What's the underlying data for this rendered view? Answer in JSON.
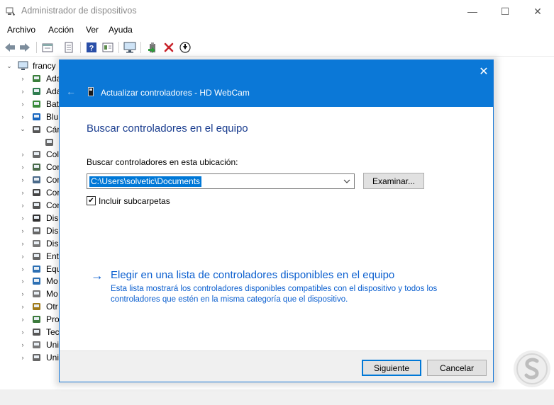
{
  "window": {
    "title": "Administrador de dispositivos",
    "minimize_glyph": "—",
    "maximize_glyph": "☐",
    "close_glyph": "✕"
  },
  "menu": [
    "Archivo",
    "Acción",
    "Ver",
    "Ayuda"
  ],
  "toolbar": {
    "icons": [
      "back-arrow-icon",
      "forward-arrow-icon",
      "properties-icon",
      "printer-icon",
      "help-icon",
      "view-icon",
      "monitor-icon",
      "update-driver-icon",
      "uninstall-icon",
      "download-icon"
    ]
  },
  "tree": {
    "root_label": "francy",
    "items": [
      {
        "label": "Ada",
        "icon": "audio-icon",
        "expander": "›"
      },
      {
        "label": "Ada",
        "icon": "display-adapter-icon",
        "expander": "›"
      },
      {
        "label": "Bat",
        "icon": "battery-icon",
        "expander": "›"
      },
      {
        "label": "Blu",
        "icon": "bluetooth-icon",
        "expander": "›"
      },
      {
        "label": "Cám",
        "icon": "camera-icon",
        "expander": "⌄"
      },
      {
        "label": "",
        "icon": "webcam-icon",
        "expander": ""
      },
      {
        "label": "Col",
        "icon": "printer-queue-icon",
        "expander": "›"
      },
      {
        "label": "Con",
        "icon": "controller-icon",
        "expander": "›"
      },
      {
        "label": "Con",
        "icon": "storage-controller-icon",
        "expander": "›"
      },
      {
        "label": "Con",
        "icon": "usb-icon",
        "expander": "›"
      },
      {
        "label": "Con",
        "icon": "usb-connector-icon",
        "expander": "›"
      },
      {
        "label": "Disp",
        "icon": "portable-device-icon",
        "expander": "›"
      },
      {
        "label": "Disp",
        "icon": "disk-icon",
        "expander": "›"
      },
      {
        "label": "Disp",
        "icon": "hid-icon",
        "expander": "›"
      },
      {
        "label": "Ent",
        "icon": "audio-input-icon",
        "expander": "›"
      },
      {
        "label": "Equ",
        "icon": "computer-icon",
        "expander": "›"
      },
      {
        "label": "Mo",
        "icon": "monitor-icon",
        "expander": "›"
      },
      {
        "label": "Mo",
        "icon": "mouse-icon",
        "expander": "›"
      },
      {
        "label": "Otr",
        "icon": "unknown-device-icon",
        "expander": "›"
      },
      {
        "label": "Pro",
        "icon": "processor-icon",
        "expander": "›"
      },
      {
        "label": "Tec",
        "icon": "keyboard-icon",
        "expander": "›"
      },
      {
        "label": "Uni",
        "icon": "dvd-icon",
        "expander": "›"
      },
      {
        "label": "Uni",
        "icon": "drive-icon",
        "expander": "›"
      }
    ]
  },
  "dialog": {
    "title": "Actualizar controladores - HD WebCam",
    "close_glyph": "✕",
    "back_glyph": "←",
    "heading": "Buscar controladores en el equipo",
    "location_label": "Buscar controladores en esta ubicación:",
    "path_value": "C:\\Users\\solvetic\\Documents",
    "browse_label": "Examinar...",
    "include_subfolders_label": "Incluir subcarpetas",
    "include_subfolders_checked": true,
    "check_glyph": "✔",
    "link_arrow": "→",
    "link_title": "Elegir en una lista de controladores disponibles en el equipo",
    "link_description": "Esta lista mostrará los controladores disponibles compatibles con el dispositivo y todos los controladores que estén en la misma categoría que el dispositivo.",
    "next_label": "Siguiente",
    "cancel_label": "Cancelar"
  },
  "colors": {
    "dialog_header": "#0b78d7",
    "heading": "#1a3d8f",
    "link": "#0b5fcf",
    "selection": "#0078d7"
  }
}
